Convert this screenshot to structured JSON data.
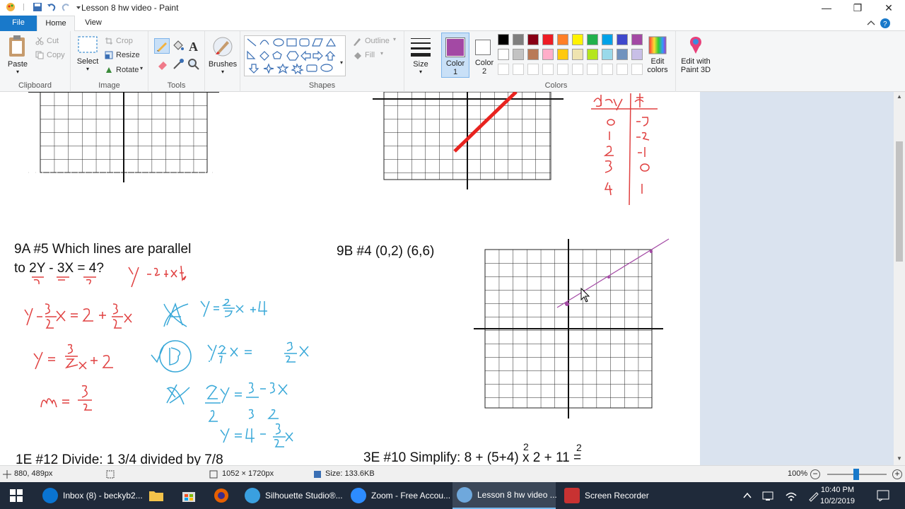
{
  "window": {
    "title": "Lesson 8 hw video - Paint",
    "controls": {
      "minimize": "—",
      "restore": "❐",
      "close": "✕"
    }
  },
  "ribbon_tabs": {
    "file": "File",
    "home": "Home",
    "view": "View"
  },
  "clipboard": {
    "paste": "Paste",
    "cut": "Cut",
    "copy": "Copy",
    "label": "Clipboard"
  },
  "image": {
    "select": "Select",
    "crop": "Crop",
    "resize": "Resize",
    "rotate": "Rotate",
    "label": "Image"
  },
  "tools": {
    "label": "Tools"
  },
  "brushes": {
    "label": "Brushes"
  },
  "shapes": {
    "outline": "Outline",
    "fill": "Fill",
    "label": "Shapes"
  },
  "size": {
    "label": "Size"
  },
  "colors": {
    "color1_label": "Color",
    "color1_num": "1",
    "color2_label": "Color",
    "color2_num": "2",
    "edit_colors_line1": "Edit",
    "edit_colors_line2": "colors",
    "paint3d_line1": "Edit with",
    "paint3d_line2": "Paint 3D",
    "label": "Colors",
    "color1_value": "#a349a4",
    "color2_value": "#ffffff",
    "palette_row1": [
      "#000000",
      "#7f7f7f",
      "#880015",
      "#ed1c24",
      "#ff7f27",
      "#fff200",
      "#22b14c",
      "#00a2e8",
      "#3f48cc",
      "#a349a4"
    ],
    "palette_row2": [
      "#ffffff",
      "#c3c3c3",
      "#b97a57",
      "#ffaec9",
      "#ffc90e",
      "#efe4b0",
      "#b5e61d",
      "#99d9ea",
      "#7092be",
      "#c8bfe7"
    ]
  },
  "canvas_text": {
    "q9a_line1": "9A #5 Which lines are parallel",
    "q9a_line2": "to 2Y - 3X = 4?",
    "q9b": "9B #4  (0,2)  (6,6)",
    "q1e": "1E #12  Divide: 1 3/4 divided by 7/8",
    "q3e": "3E #10  Simplify: 8 + (5+4) x 2 + 11 =",
    "q3e_sup1": "2",
    "q3e_sup2": "2"
  },
  "status": {
    "cursor_pos": "880, 489px",
    "dimensions": "1052 × 1720px",
    "file_size": "Size: 133.6KB",
    "zoom": "100%"
  },
  "taskbar": {
    "items": [
      {
        "label": "Inbox (8) - beckyb2...",
        "color": "#0a74d1"
      },
      {
        "label": "Silhouette Studio®...",
        "color": "#3aa0e0"
      },
      {
        "label": "Zoom - Free Accou...",
        "color": "#2d8cff"
      },
      {
        "label": "Lesson 8 hw video ...",
        "color": "#6fa8dc"
      },
      {
        "label": "Screen Recorder",
        "color": "#c83232"
      }
    ],
    "time": "10:40 PM",
    "date": "10/2/2019"
  }
}
